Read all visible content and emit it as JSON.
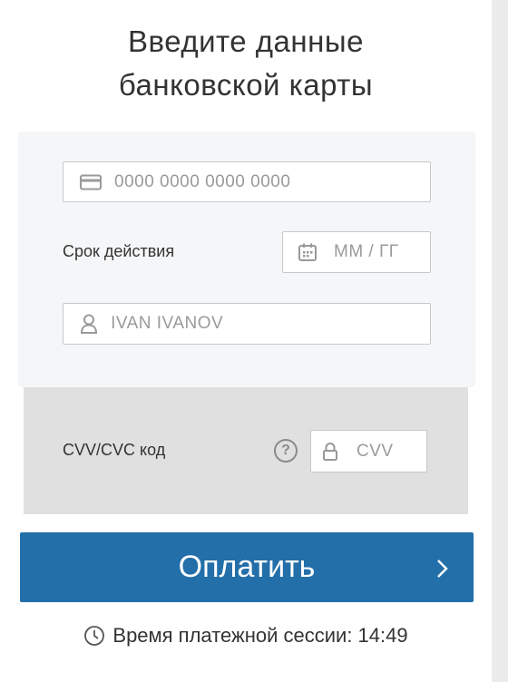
{
  "header": {
    "title_line1": "Введите данные",
    "title_line2": "банковской карты"
  },
  "card_number": {
    "placeholder": "0000 0000 0000 0000",
    "icon": "credit-card-icon"
  },
  "expiry": {
    "label": "Срок действия",
    "placeholder": "ММ / ГГ",
    "icon": "calendar-icon"
  },
  "holder": {
    "placeholder": "IVAN IVANOV",
    "icon": "user-icon"
  },
  "cvv": {
    "label": "CVV/CVC код",
    "help_symbol": "?",
    "placeholder": "CVV",
    "icon": "lock-icon"
  },
  "pay_button": {
    "label": "Оплатить",
    "icon": "chevron-right-icon"
  },
  "session": {
    "text": "Время платежной сессии: 14:49",
    "icon": "clock-icon"
  },
  "colors": {
    "button": "#236fa9",
    "card_front": "#f5f6f7",
    "card_back": "#e0e0e0"
  }
}
